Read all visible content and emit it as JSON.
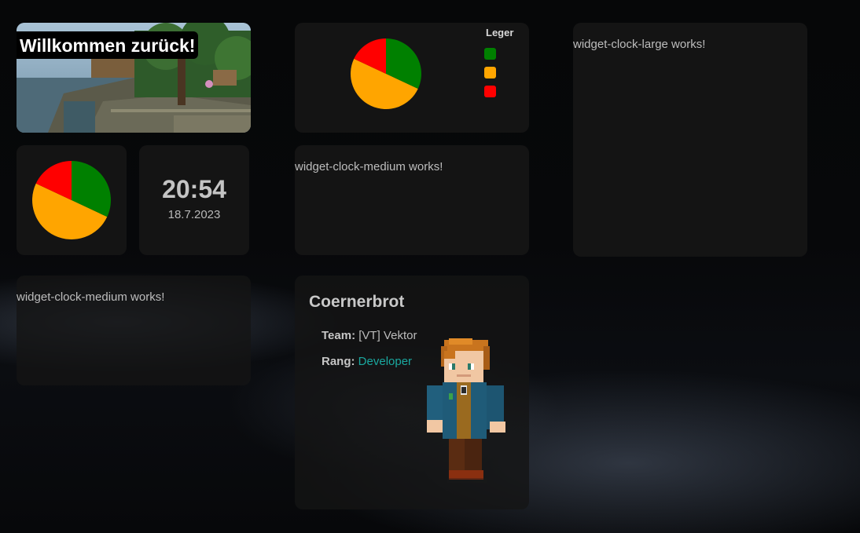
{
  "welcome": {
    "title": "Willkommen zurück!"
  },
  "pie_small": {
    "chart_data": {
      "type": "pie",
      "categories": [
        "green",
        "orange",
        "red"
      ],
      "values": [
        32,
        50,
        18
      ],
      "colors": [
        "#008000",
        "#ffa500",
        "#ff0000"
      ]
    }
  },
  "pie_medium": {
    "legend_title": "Leger",
    "chart_data": {
      "type": "pie",
      "categories": [
        "green",
        "orange",
        "red"
      ],
      "values": [
        32,
        50,
        18
      ],
      "colors": [
        "#008000",
        "#ffa500",
        "#ff0000"
      ]
    }
  },
  "clock_small": {
    "time": "20:54",
    "date": "18.7.2023"
  },
  "clock_medium_1": {
    "text": "widget-clock-medium works!"
  },
  "clock_medium_2": {
    "text": "widget-clock-medium works!"
  },
  "clock_large": {
    "text": "widget-clock-large works!"
  },
  "profile": {
    "name": "Coernerbrot",
    "team_label": "Team:",
    "team_value": "[VT] Vektor",
    "rank_label": "Rang:",
    "rank_value": "Developer",
    "rank_color": "#1aa8a0"
  }
}
